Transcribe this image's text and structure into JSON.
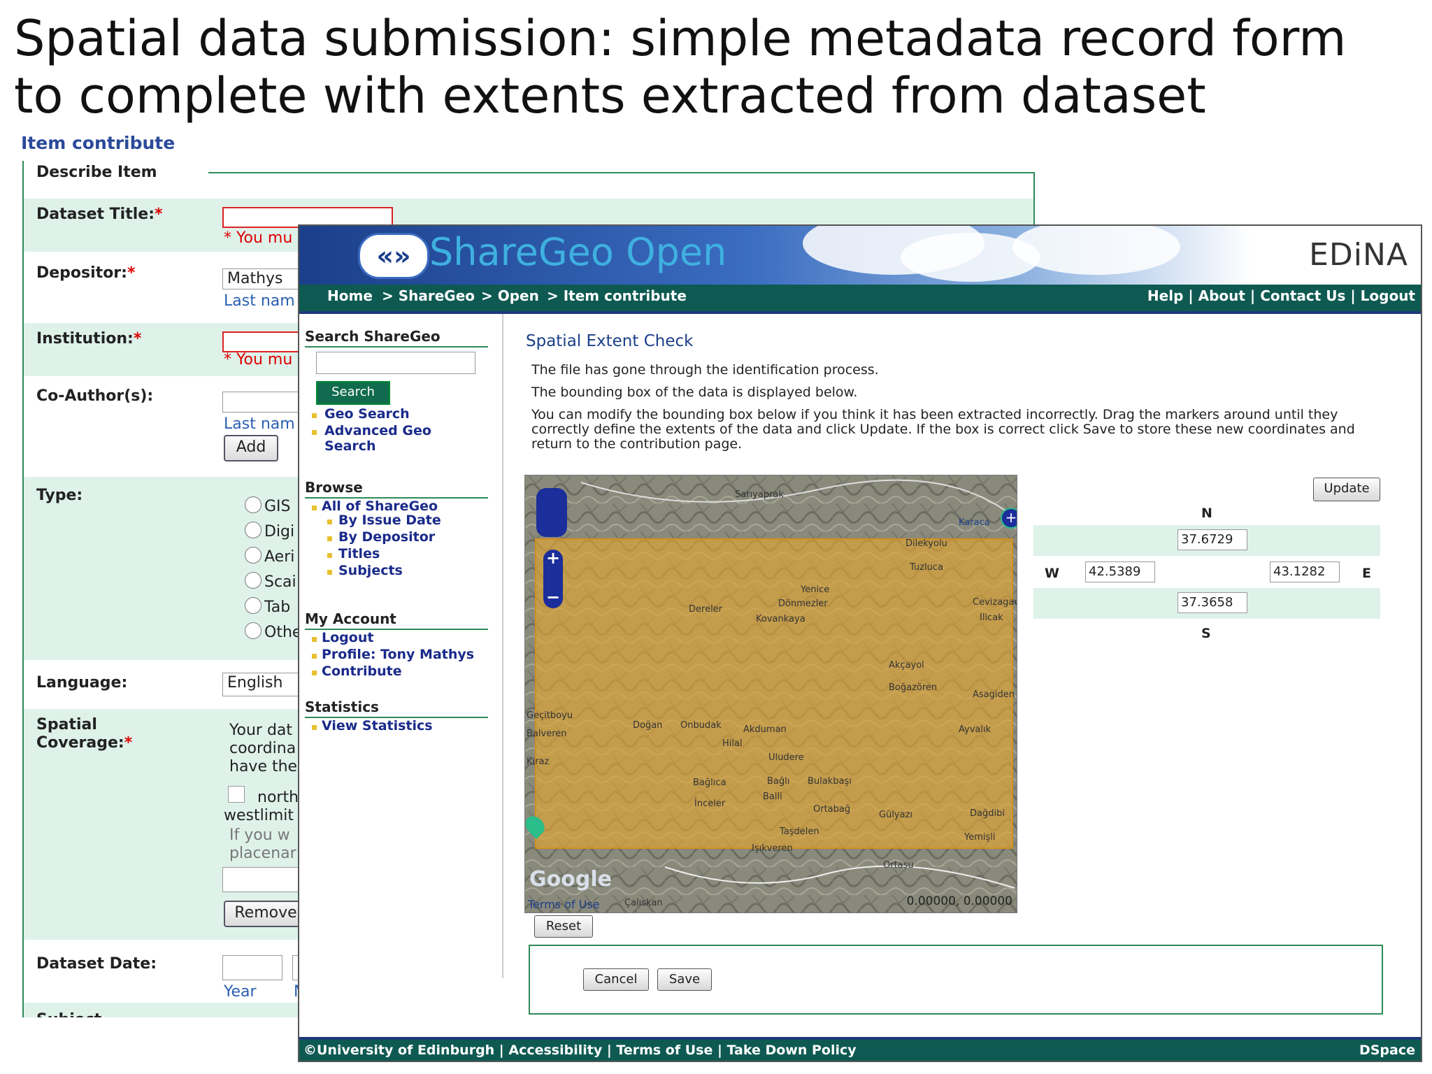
{
  "slide": {
    "title_line1": "Spatial data submission: simple metadata record form",
    "title_line2": "to complete with extents extracted from dataset"
  },
  "contribute": {
    "heading": "Item contribute",
    "subheading": "Describe Item",
    "dataset_title_label": "Dataset Title:",
    "required_mark": "*",
    "error_text": "* You mu",
    "depositor_label": "Depositor:",
    "depositor_value": "Mathys",
    "last_name_hint": "Last nam",
    "institution_label": "Institution:",
    "coauthors_label": "Co-Author(s):",
    "add_button": "Add",
    "type_label": "Type:",
    "type_options": [
      "GIS",
      "Digi",
      "Aeri",
      "Scai",
      "Tab",
      "Othe"
    ],
    "language_label": "Language:",
    "language_value": "English",
    "spatial_label_1": "Spatial",
    "spatial_label_2": "Coverage:",
    "spatial_text_1": "Your dat",
    "spatial_text_2": "coordina",
    "spatial_text_3": "have the",
    "north_text": "north",
    "westlimit_text": "westlimit",
    "ifyou_text": "If you w",
    "placename_text": "placenar",
    "remove_button": "Remove",
    "dataset_date_label": "Dataset Date:",
    "year_hint": "Year",
    "month_hint": "M",
    "subject_label": "Subject"
  },
  "sharegeo": {
    "logo_arrows": "«»",
    "logo_text": "ShareGeo Open",
    "edina": "EDiNA",
    "breadcrumb": [
      "Home",
      "> ShareGeo",
      "> Open",
      "> Item contribute"
    ],
    "toplinks": "Help | About | Contact Us | Logout",
    "search_heading": "Search ShareGeo",
    "search_button": "Search",
    "geo_search": "Geo Search",
    "advanced_geo_1": "Advanced Geo",
    "advanced_geo_2": "Search",
    "browse_heading": "Browse",
    "browse_items": [
      "All of ShareGeo",
      "By Issue Date",
      "By Depositor",
      "Titles",
      "Subjects"
    ],
    "account_heading": "My Account",
    "account_items": [
      "Logout",
      "Profile: Tony Mathys",
      "Contribute"
    ],
    "stats_heading": "Statistics",
    "stats_item": "View Statistics",
    "section_title": "Spatial Extent Check",
    "para1": "The file has gone through the identification process.",
    "para2": "The bounding box of the data is displayed below.",
    "para3": "You can modify the bounding box below if you think it has been extracted incorrectly. Drag the markers around until they correctly define the extents of the data and click Update. If the box is correct click Save to store these new coordinates and return to the contribution page.",
    "map_places": [
      "Sarıyaprak",
      "Karaca",
      "Dilekyolu",
      "Tuzluca",
      "Yenice",
      "Dönmezler",
      "Dereler",
      "Kovankaya",
      "Cevizagac",
      "Ilicak",
      "Akçayol",
      "Boğazören",
      "Asagiden",
      "Geçitboyu",
      "Balveren",
      "Doğan",
      "Onbudak",
      "Akduman",
      "Ayvalık",
      "Hilal",
      "Uludere",
      "Kiraz",
      "Bağlıca",
      "Bağlı",
      "Bulakbaşı",
      "Balli",
      "İnceler",
      "Ortabağ",
      "Gülyazı",
      "Dağdibi",
      "Yemişli",
      "Taşdelen",
      "Işıkveren",
      "Ortasu",
      "Çalıskan"
    ],
    "map_google": "Google",
    "map_terms": "Terms of Use",
    "map_coords": "0.00000, 0.00000",
    "update_button": "Update",
    "n_label": "N",
    "s_label": "S",
    "w_label": "W",
    "e_label": "E",
    "north": "37.6729",
    "south": "37.3658",
    "west": "42.5389",
    "east": "43.1282",
    "reset_button": "Reset",
    "cancel_button": "Cancel",
    "save_button": "Save",
    "footer_left": "©University of Edinburgh | Accessibility | Terms of Use | Take Down Policy",
    "footer_right": "DSpace"
  },
  "colors": {
    "accent_green": "#0e5a52",
    "row_green": "#dff2ea",
    "link_blue": "#1a2a8a",
    "bbox_orange": "#e2a632"
  }
}
